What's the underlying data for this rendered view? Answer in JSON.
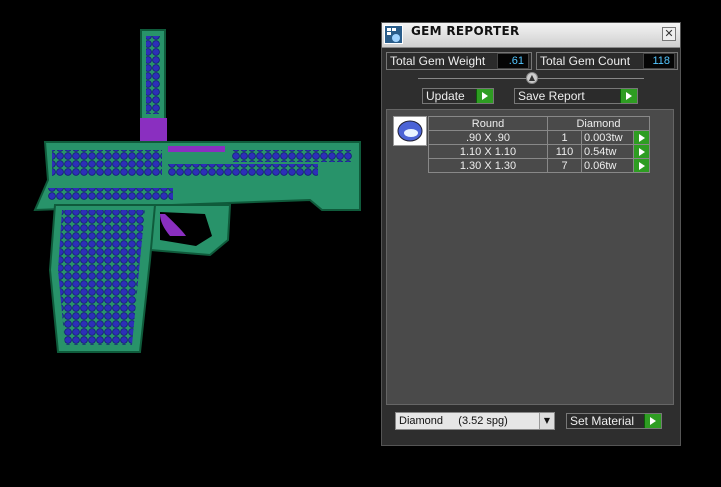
{
  "window": {
    "title": "GEM REPORTER",
    "close_glyph": "✕"
  },
  "totals": {
    "weight_label": "Total Gem Weight",
    "weight_value": ".61",
    "count_label": "Total Gem Count",
    "count_value": "118"
  },
  "toolbar": {
    "update_label": "Update",
    "save_report_label": "Save Report"
  },
  "table": {
    "headers": [
      "Round",
      "Diamond"
    ],
    "rows": [
      {
        "size": ".90 X .90",
        "count": "1",
        "weight": "0.003tw"
      },
      {
        "size": "1.10 X 1.10",
        "count": "110",
        "weight": "0.54tw"
      },
      {
        "size": "1.30 X 1.30",
        "count": "7",
        "weight": "0.06tw"
      }
    ]
  },
  "material": {
    "selected": "Diamond     (3.52 spg)",
    "set_label": "Set Material"
  },
  "colors": {
    "model_green": "#28936a",
    "gem_blue": "#2d2fb8",
    "accent_green": "#2e9d22",
    "value_blue": "#53c6ff"
  },
  "icons": {
    "app": "gem-reporter-icon",
    "gem": "round-gem-icon",
    "close": "close-icon"
  }
}
